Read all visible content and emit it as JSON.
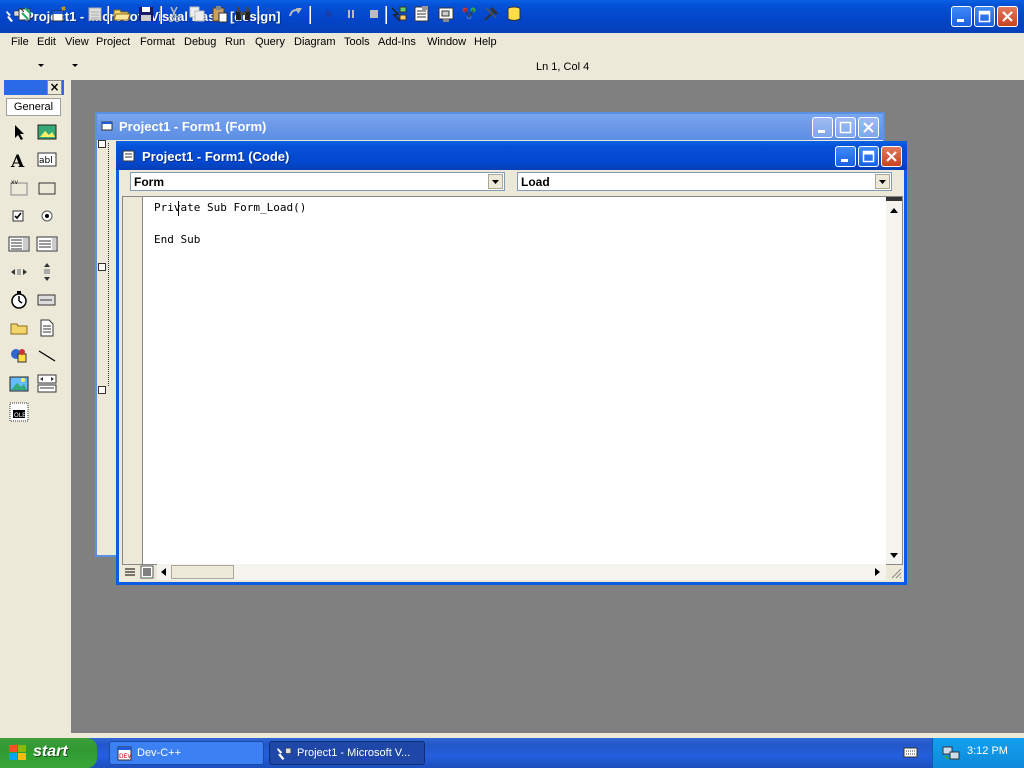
{
  "window": {
    "title": "Project1 - Microsoft Visual Basic [design]"
  },
  "menu": [
    "File",
    "Edit",
    "View",
    "Project",
    "Format",
    "Debug",
    "Run",
    "Query",
    "Diagram",
    "Tools",
    "Add-Ins",
    "Window",
    "Help"
  ],
  "toolbar": {
    "position": "Ln 1, Col 4"
  },
  "toolbox": {
    "tab": "General",
    "close": "×"
  },
  "form_window": {
    "title": "Project1 - Form1 (Form)"
  },
  "code_window": {
    "title": "Project1 - Form1 (Code)",
    "object_combo": "Form",
    "procedure_combo": "Load",
    "lines": [
      "Private Sub Form_Load()",
      "",
      "End Sub"
    ]
  },
  "taskbar": {
    "start": "start",
    "tasks": [
      {
        "label": "Dev-C++"
      },
      {
        "label": "Project1 - Microsoft V..."
      }
    ],
    "clock": "3:12 PM"
  }
}
